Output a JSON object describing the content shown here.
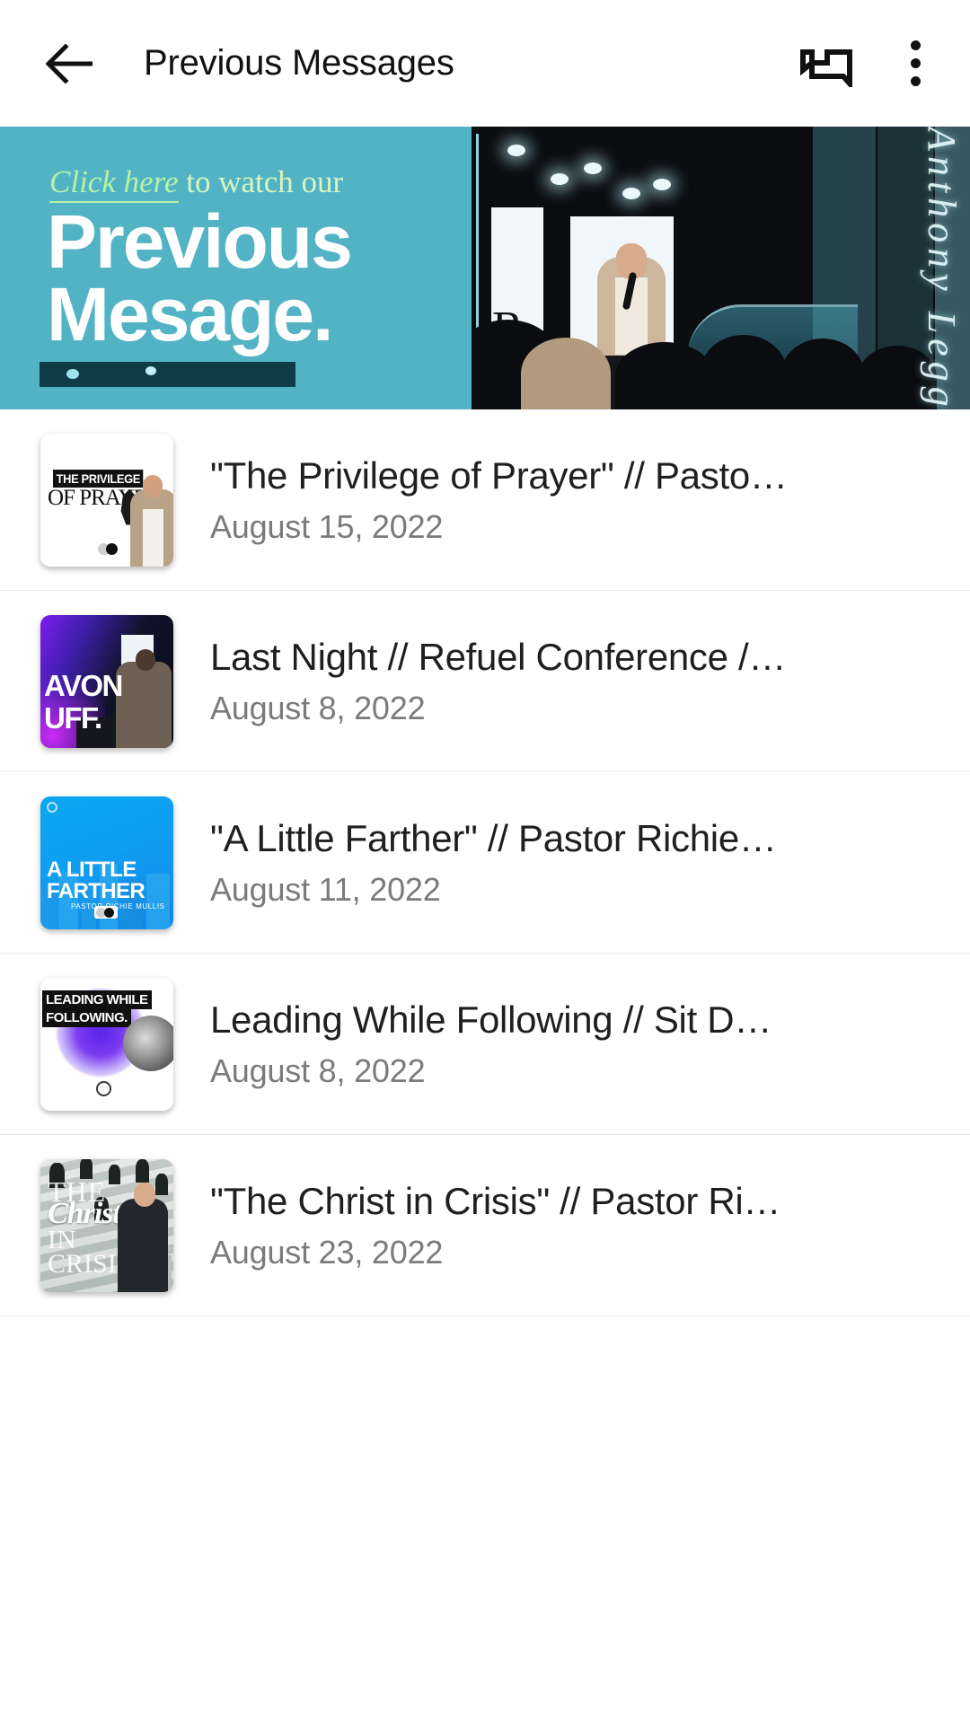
{
  "appbar": {
    "back_icon": "back-arrow-icon",
    "title": "Previous Messages",
    "cast_icon": "cast-icon",
    "overflow_icon": "more-vert-icon"
  },
  "banner": {
    "kicker_link": "Click here",
    "kicker_rest": " to watch our",
    "headline_line1": "Previous",
    "headline_line2": "Mesage.",
    "signature": "Anthony Leggs",
    "stage_letter": "R",
    "bg_color": "#52b3c5",
    "accent_color": "#b9f2a4"
  },
  "list": {
    "items": [
      {
        "title": "\"The Privilege of Prayer\" // Pasto…",
        "date": "August 15, 2022",
        "thumb_name": "thumbnail-privilege-of-prayer",
        "art": {
          "line1": "THE PRIVILEGE",
          "line2": "OF PRAYER"
        }
      },
      {
        "title": "Last Night // Refuel Conference /…",
        "date": "August 8, 2022",
        "thumb_name": "thumbnail-last-night-refuel",
        "art": {
          "line1": "AVON",
          "line2": "UFF."
        }
      },
      {
        "title": "\"A Little Farther\" // Pastor Richie…",
        "date": "August 11, 2022",
        "thumb_name": "thumbnail-a-little-farther",
        "art": {
          "line1": "A LITTLE",
          "line2": "FARTHER",
          "line3": "PASTOR RICHIE MULLIS"
        }
      },
      {
        "title": "Leading While Following // Sit Do…",
        "date": "August 8, 2022",
        "thumb_name": "thumbnail-leading-while-following",
        "art": {
          "line1": "LEADING WHILE",
          "line2": "FOLLOWING."
        }
      },
      {
        "title": "\"The Christ in Crisis\" // Pastor Ri…",
        "date": "August 23, 2022",
        "thumb_name": "thumbnail-the-christ-in-crisis",
        "art": {
          "line1": "THE",
          "line2": "Christ",
          "line3": "IN",
          "line4": "CRISIS"
        }
      }
    ]
  }
}
